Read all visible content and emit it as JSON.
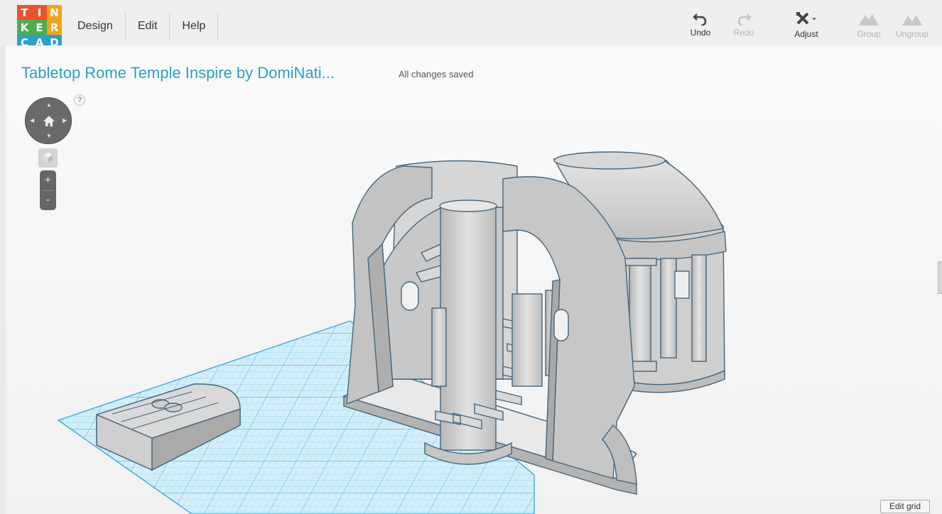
{
  "logo": {
    "letters": [
      "T",
      "I",
      "N",
      "K",
      "E",
      "R",
      "C",
      "A",
      "D"
    ],
    "colors": [
      "#e8552d",
      "#e8552d",
      "#f2a31e",
      "#4cae4f",
      "#4cae4f",
      "#f2a31e",
      "#2d9fcb",
      "#2d9fcb",
      "#2d9fcb"
    ]
  },
  "menu": {
    "items": [
      "Design",
      "Edit",
      "Help"
    ]
  },
  "toolbar": {
    "undo": "Undo",
    "redo": "Redo",
    "adjust": "Adjust",
    "group": "Group",
    "ungroup": "Ungroup"
  },
  "design": {
    "title": "Tabletop Rome Temple Inspire by DomiNati...",
    "status": "All changes saved"
  },
  "nav": {
    "help": "?",
    "zoom_in": "+",
    "zoom_out": "-"
  },
  "edit_grid": {
    "label": "Edit grid"
  },
  "colors": {
    "accent": "#2aa1c0",
    "grid": "#6cc6e8",
    "model": "#c9c9c9",
    "model_outline": "#45657e"
  }
}
